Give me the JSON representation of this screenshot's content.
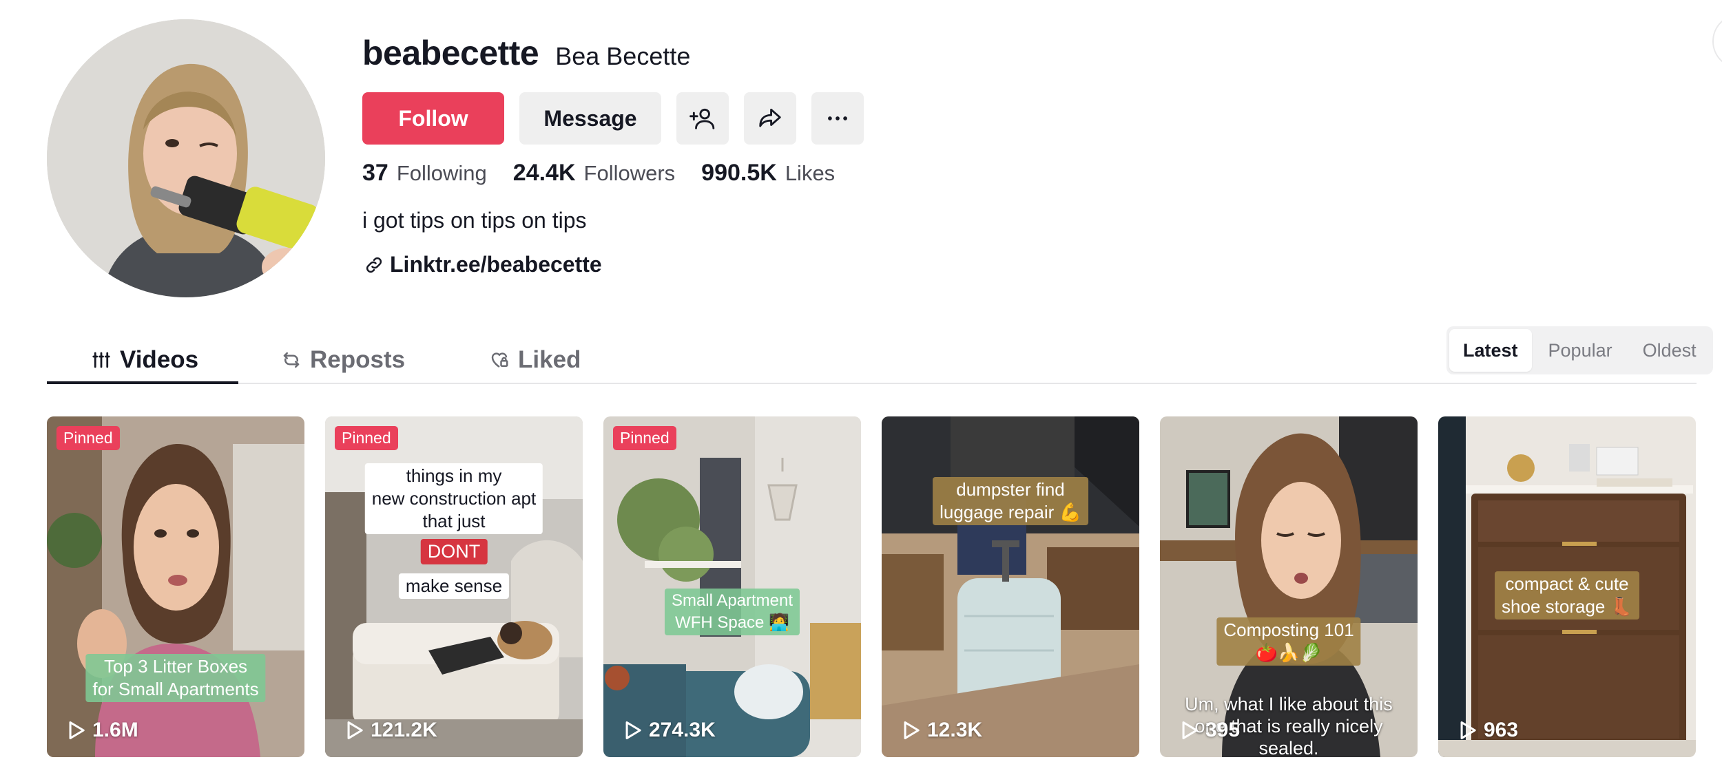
{
  "profile": {
    "username": "beabecette",
    "nickname": "Bea Becette",
    "bio": "i got tips on tips on tips",
    "link": "Linktr.ee/beabecette"
  },
  "actions": {
    "follow": "Follow",
    "message": "Message"
  },
  "stats": {
    "following_count": "37",
    "following_label": "Following",
    "followers_count": "24.4K",
    "followers_label": "Followers",
    "likes_count": "990.5K",
    "likes_label": "Likes"
  },
  "tabs": {
    "videos": "Videos",
    "reposts": "Reposts",
    "liked": "Liked"
  },
  "sort": {
    "latest": "Latest",
    "popular": "Popular",
    "oldest": "Oldest"
  },
  "colors": {
    "accent": "#ea405b"
  },
  "videos": [
    {
      "pinned": "Pinned",
      "views": "1.6M",
      "overlay_line1": "Top 3 Litter Boxes",
      "overlay_line2": "for Small Apartments"
    },
    {
      "pinned": "Pinned",
      "views": "121.2K",
      "overlay_line1": "things in my",
      "overlay_line2": "new construction apt",
      "overlay_line3": "that just",
      "overlay_line4": "DONT",
      "overlay_line5": "make sense"
    },
    {
      "pinned": "Pinned",
      "views": "274.3K",
      "overlay_line1": "Small Apartment",
      "overlay_line2": "WFH Space 🧑‍💻"
    },
    {
      "views": "12.3K",
      "overlay_line1": "dumpster find",
      "overlay_line2": "luggage repair 💪"
    },
    {
      "views": "395",
      "overlay_line1": "Composting 101",
      "overlay_line2": "🍅🍌🥬",
      "caption_line1": "Um, what I like about this",
      "caption_line2": "one that is really nicely",
      "caption_line3": "sealed."
    },
    {
      "views": "963",
      "overlay_line1": "compact & cute",
      "overlay_line2": "shoe storage 👢"
    }
  ]
}
